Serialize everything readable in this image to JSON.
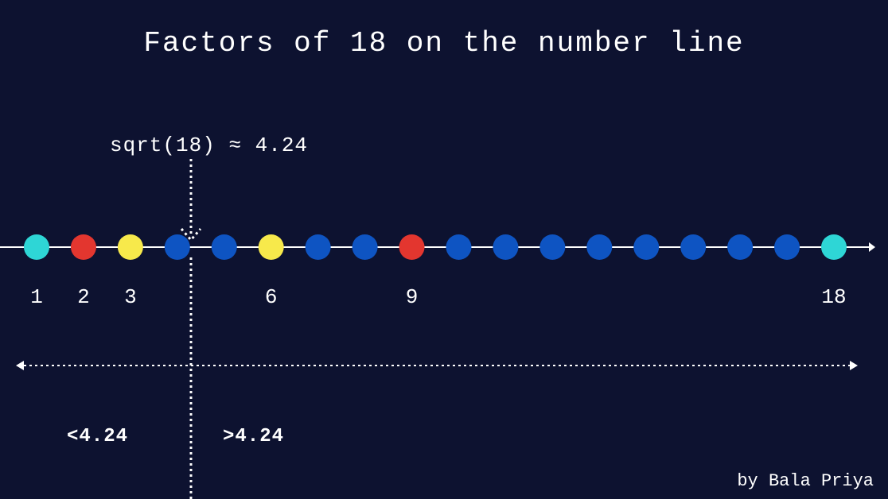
{
  "title": "Factors of 18 on the number line",
  "sqrt_label": "sqrt(18) ≈ 4.24",
  "region_left_label": "<4.24",
  "region_right_label": ">4.24",
  "credit": "by Bala Priya",
  "chart_data": {
    "type": "scatter",
    "title": "Factors of 18 on the number line",
    "xlabel": "",
    "ylabel": "",
    "xlim": [
      1,
      18
    ],
    "sqrt_marker": 4.24,
    "points": [
      {
        "value": 1,
        "label": "1",
        "color": "#2ed6d6",
        "is_factor": true
      },
      {
        "value": 2,
        "label": "2",
        "color": "#e3362f",
        "is_factor": true
      },
      {
        "value": 3,
        "label": "3",
        "color": "#f7e94b",
        "is_factor": true
      },
      {
        "value": 4,
        "label": "",
        "color": "#0e54c2",
        "is_factor": false
      },
      {
        "value": 5,
        "label": "",
        "color": "#0e54c2",
        "is_factor": false
      },
      {
        "value": 6,
        "label": "6",
        "color": "#f7e94b",
        "is_factor": true
      },
      {
        "value": 7,
        "label": "",
        "color": "#0e54c2",
        "is_factor": false
      },
      {
        "value": 8,
        "label": "",
        "color": "#0e54c2",
        "is_factor": false
      },
      {
        "value": 9,
        "label": "9",
        "color": "#e3362f",
        "is_factor": true
      },
      {
        "value": 10,
        "label": "",
        "color": "#0e54c2",
        "is_factor": false
      },
      {
        "value": 11,
        "label": "",
        "color": "#0e54c2",
        "is_factor": false
      },
      {
        "value": 12,
        "label": "",
        "color": "#0e54c2",
        "is_factor": false
      },
      {
        "value": 13,
        "label": "",
        "color": "#0e54c2",
        "is_factor": false
      },
      {
        "value": 14,
        "label": "",
        "color": "#0e54c2",
        "is_factor": false
      },
      {
        "value": 15,
        "label": "",
        "color": "#0e54c2",
        "is_factor": false
      },
      {
        "value": 16,
        "label": "",
        "color": "#0e54c2",
        "is_factor": false
      },
      {
        "value": 17,
        "label": "",
        "color": "#0e54c2",
        "is_factor": false
      },
      {
        "value": 18,
        "label": "18",
        "color": "#2ed6d6",
        "is_factor": true
      }
    ]
  }
}
